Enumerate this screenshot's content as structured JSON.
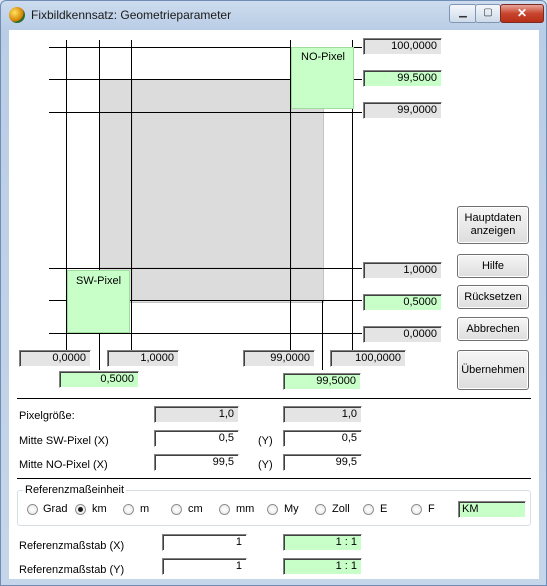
{
  "window": {
    "title": "Fixbildkennsatz: Geometrieparameter",
    "minimize": "▁",
    "restore": "▢",
    "close": "✕"
  },
  "diagram": {
    "no_pixel": "NO-Pixel",
    "sw_pixel": "SW-Pixel",
    "right_top_max": "100,0000",
    "right_top_pixel": "99,5000",
    "right_top_min": "99,0000",
    "right_bot_max": "1,0000",
    "right_bot_pixel": "0,5000",
    "right_bot_min": "0,0000",
    "bottom_left_min": "0,0000",
    "bottom_left_max": "1,0000",
    "bottom_left_pixel": "0,5000",
    "bottom_right_min": "99,0000",
    "bottom_right_max": "100,0000",
    "bottom_right_pixel": "99,5000"
  },
  "buttons": {
    "hauptdaten_line1": "Hauptdaten",
    "hauptdaten_line2": "anzeigen",
    "hilfe": "Hilfe",
    "ruecksetzen": "Rücksetzen",
    "abbrechen": "Abbrechen",
    "uebernehmen": "Übernehmen"
  },
  "params": {
    "pixelgroesse_label": "Pixelgröße:",
    "pixelgroesse_x": "1,0",
    "pixelgroesse_y": "1,0",
    "mitte_sw_label": "Mitte SW-Pixel (X)",
    "mitte_sw_x": "0,5",
    "mitte_sw_y": "0,5",
    "mitte_no_label": "Mitte NO-Pixel (X)",
    "mitte_no_x": "99,5",
    "mitte_no_y": "99,5",
    "y_label": "(Y)"
  },
  "referenz": {
    "group_label": "Referenzmaßeinheit",
    "options": [
      "Grad",
      "km",
      "m",
      "cm",
      "mm",
      "My",
      "Zoll",
      "E",
      "F"
    ],
    "selected": "km",
    "unit_display": "KM",
    "massstab_x_label": "Referenzmaßstab (X)",
    "massstab_x_value": "1",
    "massstab_x_ratio": "1 : 1",
    "massstab_y_label": "Referenzmaßstab (Y)",
    "massstab_y_value": "1",
    "massstab_y_ratio": "1 : 1"
  }
}
